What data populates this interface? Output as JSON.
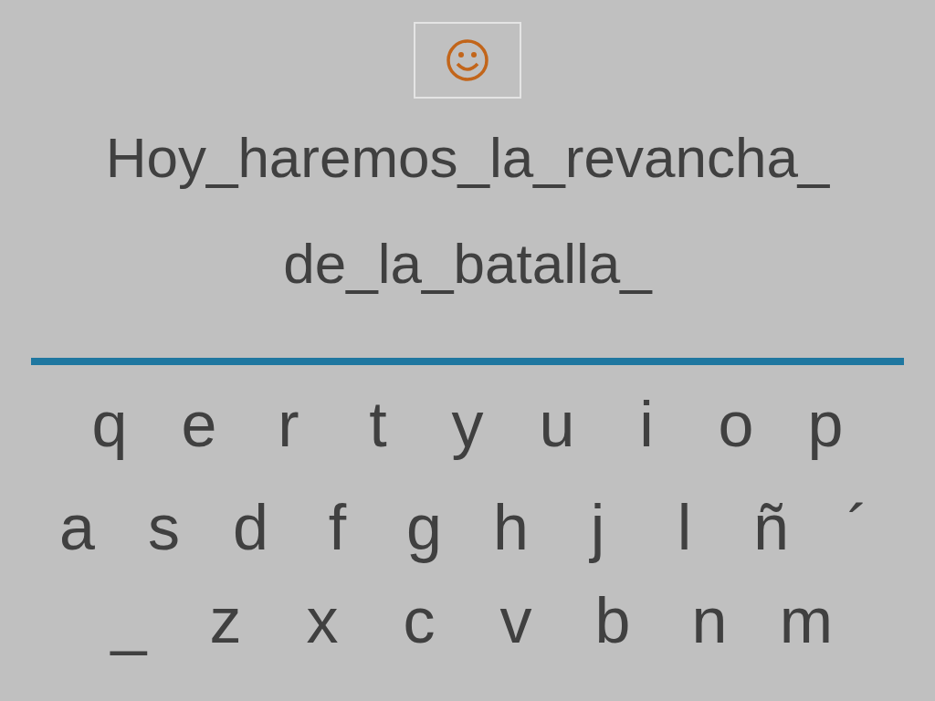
{
  "phrase_lines": [
    "Hoy_haremos_la_revancha_",
    "de_la_batalla_"
  ],
  "keyboard_rows": [
    [
      "q",
      "e",
      "r",
      "t",
      "y",
      "u",
      "i",
      "o",
      "p"
    ],
    [
      "a",
      "s",
      "d",
      "f",
      "g",
      "h",
      "j",
      "l",
      "ñ",
      "´"
    ],
    [
      "_",
      "z",
      "x",
      "c",
      "v",
      "b",
      "n",
      "m"
    ]
  ]
}
